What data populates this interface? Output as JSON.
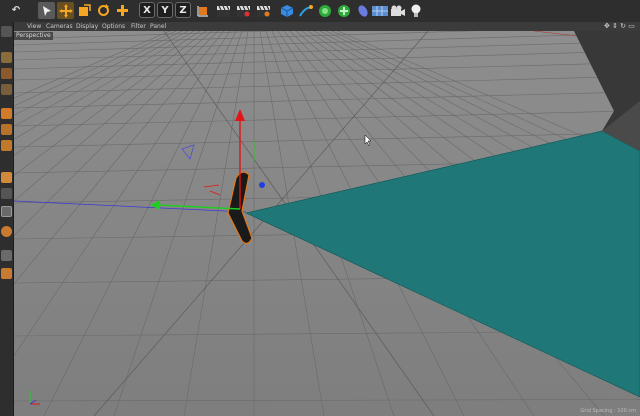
{
  "toolbar": {
    "undo_label": "↶",
    "axis_x": "X",
    "axis_y": "Y",
    "axis_z": "Z",
    "icons": [
      "undo-icon",
      "live-select-icon",
      "move-icon",
      "scale-icon",
      "rotate-icon",
      "add-icon",
      "axis-x",
      "axis-y",
      "axis-z",
      "coordinate-system-icon",
      "render-view-icon",
      "render-picture-viewer-icon",
      "render-settings-icon",
      "cube-icon",
      "pen-icon",
      "subdivision-icon",
      "array-icon",
      "deformer-icon",
      "scene-icon",
      "camera-icon",
      "light-icon"
    ]
  },
  "menu": {
    "items": [
      "View",
      "Cameras",
      "Display",
      "Options",
      "Filter",
      "Panel"
    ]
  },
  "viewport": {
    "label": "Perspective",
    "status_text": "Grid Spacing : 100 cm"
  },
  "colors": {
    "teal_plane": "#1f7777",
    "grid": "#6a6a6a",
    "floor": "#858585",
    "sky": "#8a8a8a",
    "axis_x": "#e11515",
    "axis_y": "#22cc22",
    "axis_z": "#1f3fe0"
  },
  "sidebar": {
    "icons": [
      "make-editable-icon",
      "model-mode-icon",
      "texture-mode-icon",
      "object-axis-icon",
      "points-mode-icon",
      "edges-mode-icon",
      "polygons-mode-icon",
      "enable-axis-icon",
      "soft-selection-icon",
      "snap-icon",
      "workplane-icon",
      "lock-icon",
      "magnet-icon"
    ]
  }
}
